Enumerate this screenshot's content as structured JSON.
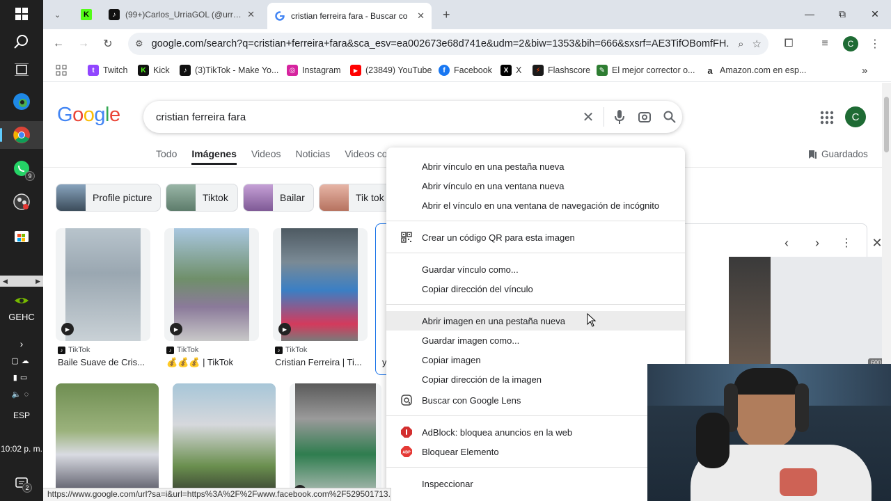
{
  "taskbar": {
    "time": "10:02 p. m.",
    "language": "ESP",
    "gpu_label": "GEHC",
    "whatsapp_badge": "9",
    "notif_badge": "2"
  },
  "tabs": [
    {
      "title": "",
      "icon": "kick-icon"
    },
    {
      "title": "(99+)Carlos_UrriaGOL (@urriag",
      "icon": "tiktok-icon"
    },
    {
      "title": "cristian ferreira fara - Buscar co",
      "icon": "google-icon",
      "active": true
    }
  ],
  "omnibox": {
    "url": "google.com/search?q=cristian+ferreira+fara&sca_esv=ea002673e68d741e&udm=2&biw=1353&bih=666&sxsrf=AE3TifOBomfFH..."
  },
  "profile_initial": "C",
  "bookmarks": [
    {
      "label": "Twitch",
      "color": "#9146ff",
      "glyph": "t"
    },
    {
      "label": "Kick",
      "color": "#111111",
      "glyph": "K"
    },
    {
      "label": "(3)TikTok - Make Yo...",
      "color": "#111111",
      "glyph": "♪"
    },
    {
      "label": "Instagram",
      "color": "#d6249f",
      "glyph": "◎"
    },
    {
      "label": "(23849) YouTube",
      "color": "#ff0000",
      "glyph": "▶"
    },
    {
      "label": "Facebook",
      "color": "#1877f2",
      "glyph": "f"
    },
    {
      "label": "X",
      "color": "#000000",
      "glyph": "X"
    },
    {
      "label": "Flashscore",
      "color": "#1a1a1a",
      "glyph": "⚡"
    },
    {
      "label": "El mejor corrector o...",
      "color": "#2e7d32",
      "glyph": "✎"
    },
    {
      "label": "Amazon.com en esp...",
      "color": "#222222",
      "glyph": "a"
    }
  ],
  "search": {
    "query": "cristian ferreira fara"
  },
  "nav_tabs": [
    "Todo",
    "Imágenes",
    "Videos",
    "Noticias",
    "Videos corto"
  ],
  "saved_label": "Guardados",
  "chips": [
    "Profile picture",
    "Tiktok",
    "Bailar",
    "Tik tok"
  ],
  "results": [
    {
      "source": "TikTok",
      "title": "Baile Suave de Cris..."
    },
    {
      "source": "TikTok",
      "title": "💰💰💰 | TikTok"
    },
    {
      "source": "TikTok",
      "title": "Cristian Ferreira | Ti..."
    },
    {
      "source": "",
      "title": "y"
    }
  ],
  "preview": {
    "size_label": "600 × 800"
  },
  "context_menu": {
    "group1": [
      "Abrir vínculo en una pestaña nueva",
      "Abrir vínculo en una ventana nueva",
      "Abrir el vínculo en una ventana de navegación de incógnito"
    ],
    "qr": "Crear un código QR para esta imagen",
    "group2": [
      "Guardar vínculo como...",
      "Copiar dirección del vínculo"
    ],
    "group3": [
      "Abrir imagen en una pestaña nueva",
      "Guardar imagen como...",
      "Copiar imagen",
      "Copiar dirección de la imagen"
    ],
    "lens": "Buscar con Google Lens",
    "adblock": "AdBlock: bloquea anuncios en la web",
    "abp": "Bloquear Elemento",
    "inspect": "Inspeccionar"
  },
  "status_url": "https://www.google.com/url?sa=i&url=https%3A%2F%2Fwww.facebook.com%2F529501713..."
}
